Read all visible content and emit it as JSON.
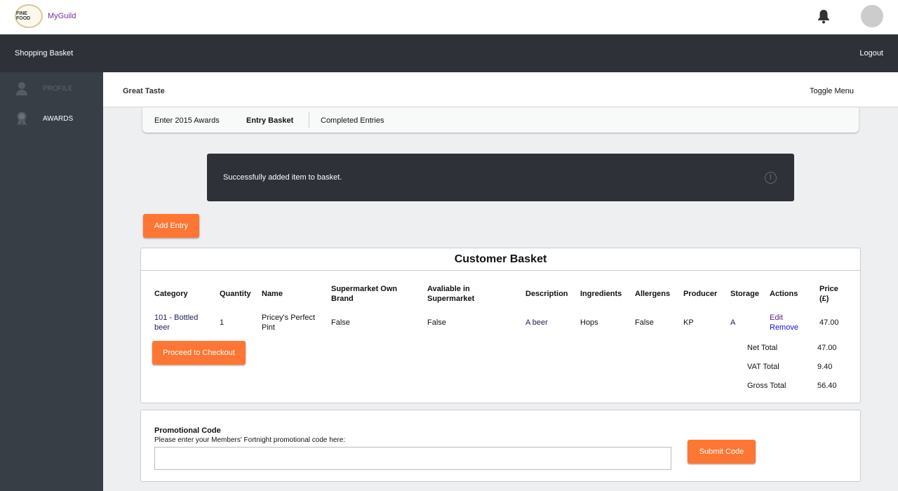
{
  "topbar": {
    "logo_text": "FINE FOOD",
    "brand": "MyGuild"
  },
  "navbar": {
    "title": "Shopping Basket",
    "logout": "Logout"
  },
  "sidebar": {
    "items": [
      {
        "label": "PROFILE",
        "icon": "user-icon"
      },
      {
        "label": "AWARDS",
        "icon": "award-icon"
      }
    ]
  },
  "header": {
    "title": "Great Taste",
    "toggle": "Toggle Menu"
  },
  "tabs": [
    {
      "label": "Enter 2015 Awards"
    },
    {
      "label": "Entry Basket",
      "active": true
    },
    {
      "label": "Completed Entries"
    }
  ],
  "alert": {
    "message": "Successfully added item to basket.",
    "icon": "exclamation-circle-icon"
  },
  "add_entry": "Add Entry",
  "basket": {
    "title": "Customer Basket",
    "columns": [
      "Category",
      "Quantity",
      "Name",
      "Supermarket Own Brand",
      "Avaliable in Supermarket",
      "Description",
      "Ingredients",
      "Allergens",
      "Producer",
      "Storage",
      "Actions",
      "Price (£)"
    ],
    "rows": [
      {
        "category": "101 - Bottled beer",
        "quantity": "1",
        "name": "Pricey's Perfect Pint",
        "own_brand": "False",
        "available": "False",
        "description": "A beer",
        "ingredients": "Hops",
        "allergens": "False",
        "producer": "KP",
        "storage": "A",
        "edit": "Edit",
        "remove": "Remove",
        "price": "47.00"
      }
    ],
    "checkout": "Proceed to Checkout",
    "totals": [
      {
        "label": "Net Total",
        "value": "47.00"
      },
      {
        "label": "VAT Total",
        "value": "9.40"
      },
      {
        "label": "Gross Total",
        "value": "56.40"
      }
    ]
  },
  "promo": {
    "title": "Promotional Code",
    "hint": "Please enter your Members' Fortnight promotional code here:",
    "value": "",
    "submit": "Submit Code"
  },
  "colors": {
    "accent": "#fd7634",
    "nav": "#2e3138",
    "sidebar": "#373e46"
  }
}
